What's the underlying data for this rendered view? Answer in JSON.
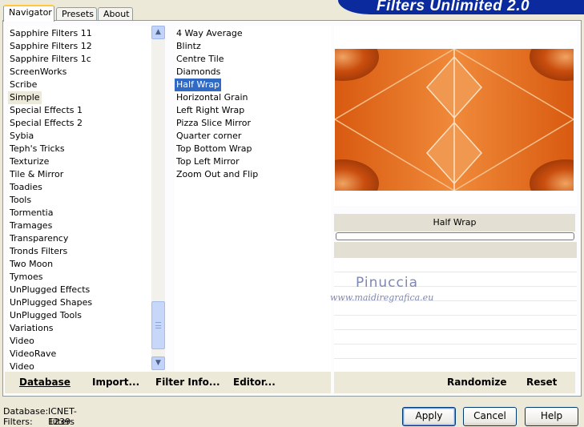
{
  "brand": {
    "title": "Filters Unlimited 2.0"
  },
  "tabs": [
    {
      "label": "Navigator",
      "active": true
    },
    {
      "label": "Presets",
      "active": false
    },
    {
      "label": "About",
      "active": false
    }
  ],
  "categories": {
    "items": [
      "Sapphire Filters 11",
      "Sapphire Filters 12",
      "Sapphire Filters 1c",
      "ScreenWorks",
      "Scribe",
      "Simple",
      "Special Effects 1",
      "Special Effects 2",
      "Sybia",
      "Teph's Tricks",
      "Texturize",
      "Tile & Mirror",
      "Toadies",
      "Tools",
      "Tormentia",
      "Tramages",
      "Transparency",
      "Tronds Filters",
      "Two Moon",
      "Tymoes",
      "UnPlugged Effects",
      "UnPlugged Shapes",
      "UnPlugged Tools",
      "Variations",
      "Video",
      "VideoRave",
      "Video"
    ],
    "selected": "Simple"
  },
  "filters": {
    "items": [
      "4 Way Average",
      "Blintz",
      "Centre Tile",
      "Diamonds",
      "Half Wrap",
      "Horizontal Grain",
      "Left Right Wrap",
      "Pizza Slice Mirror",
      "Quarter corner",
      "Top Bottom Wrap",
      "Top Left Mirror",
      "Zoom Out and Flip"
    ],
    "selected": "Half Wrap"
  },
  "scrollbar": {
    "up_icon": "arrow-up-icon",
    "down_icon": "arrow-down-icon",
    "up_glyph": "▲",
    "down_glyph": "▼"
  },
  "preview": {
    "filter_name": "Half Wrap"
  },
  "watermark": {
    "name": "Pinuccia",
    "site": "www.maidiregrafica.eu"
  },
  "toolbar": {
    "database": "Database",
    "import": "Import...",
    "filter_info": "Filter Info...",
    "editor": "Editor...",
    "randomize": "Randomize",
    "reset": "Reset"
  },
  "status": {
    "database_label": "Database:",
    "database_value": "ICNET-Filters",
    "filters_label": "Filters:",
    "filters_value": "1239"
  },
  "buttons": {
    "apply": "Apply",
    "cancel": "Cancel",
    "help": "Help"
  },
  "colors": {
    "brand": "#0a2a9e",
    "selection": "#316ac5",
    "preview_orange": "#e87420"
  }
}
